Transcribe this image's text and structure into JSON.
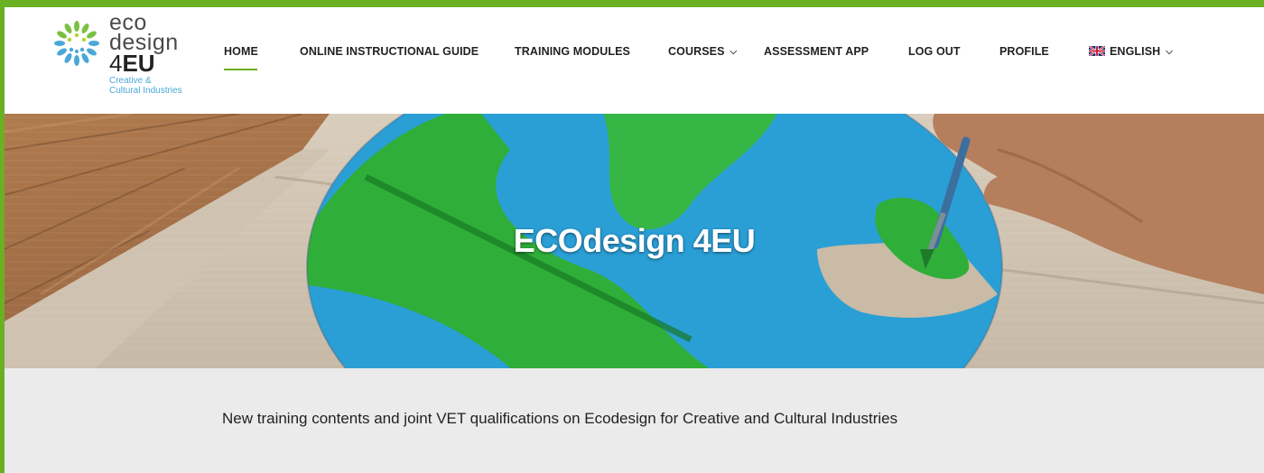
{
  "logo": {
    "line1": "eco",
    "line2": "design",
    "line3_num": "4",
    "line3_eu": "EU",
    "sub1": "Creative &",
    "sub2": "Cultural Industries"
  },
  "nav": {
    "home": "HOME",
    "guide": "ONLINE INSTRUCTIONAL GUIDE",
    "modules": "TRAINING MODULES",
    "courses": "COURSES",
    "assessment": "ASSESSMENT APP",
    "logout": "LOG OUT",
    "profile": "PROFILE",
    "language": "ENGLISH"
  },
  "hero": {
    "title": "ECOdesign 4EU"
  },
  "tagline": "New training contents and joint VET qualifications on Ecodesign for Creative and Cultural Industries",
  "colors": {
    "accent": "#6ab023",
    "band": "#ebebeb",
    "logo_blue": "#4aa8d8"
  },
  "icons": {
    "courses_dropdown": "chevron-down-icon",
    "language_dropdown": "chevron-down-icon",
    "flag": "uk-flag-icon"
  }
}
